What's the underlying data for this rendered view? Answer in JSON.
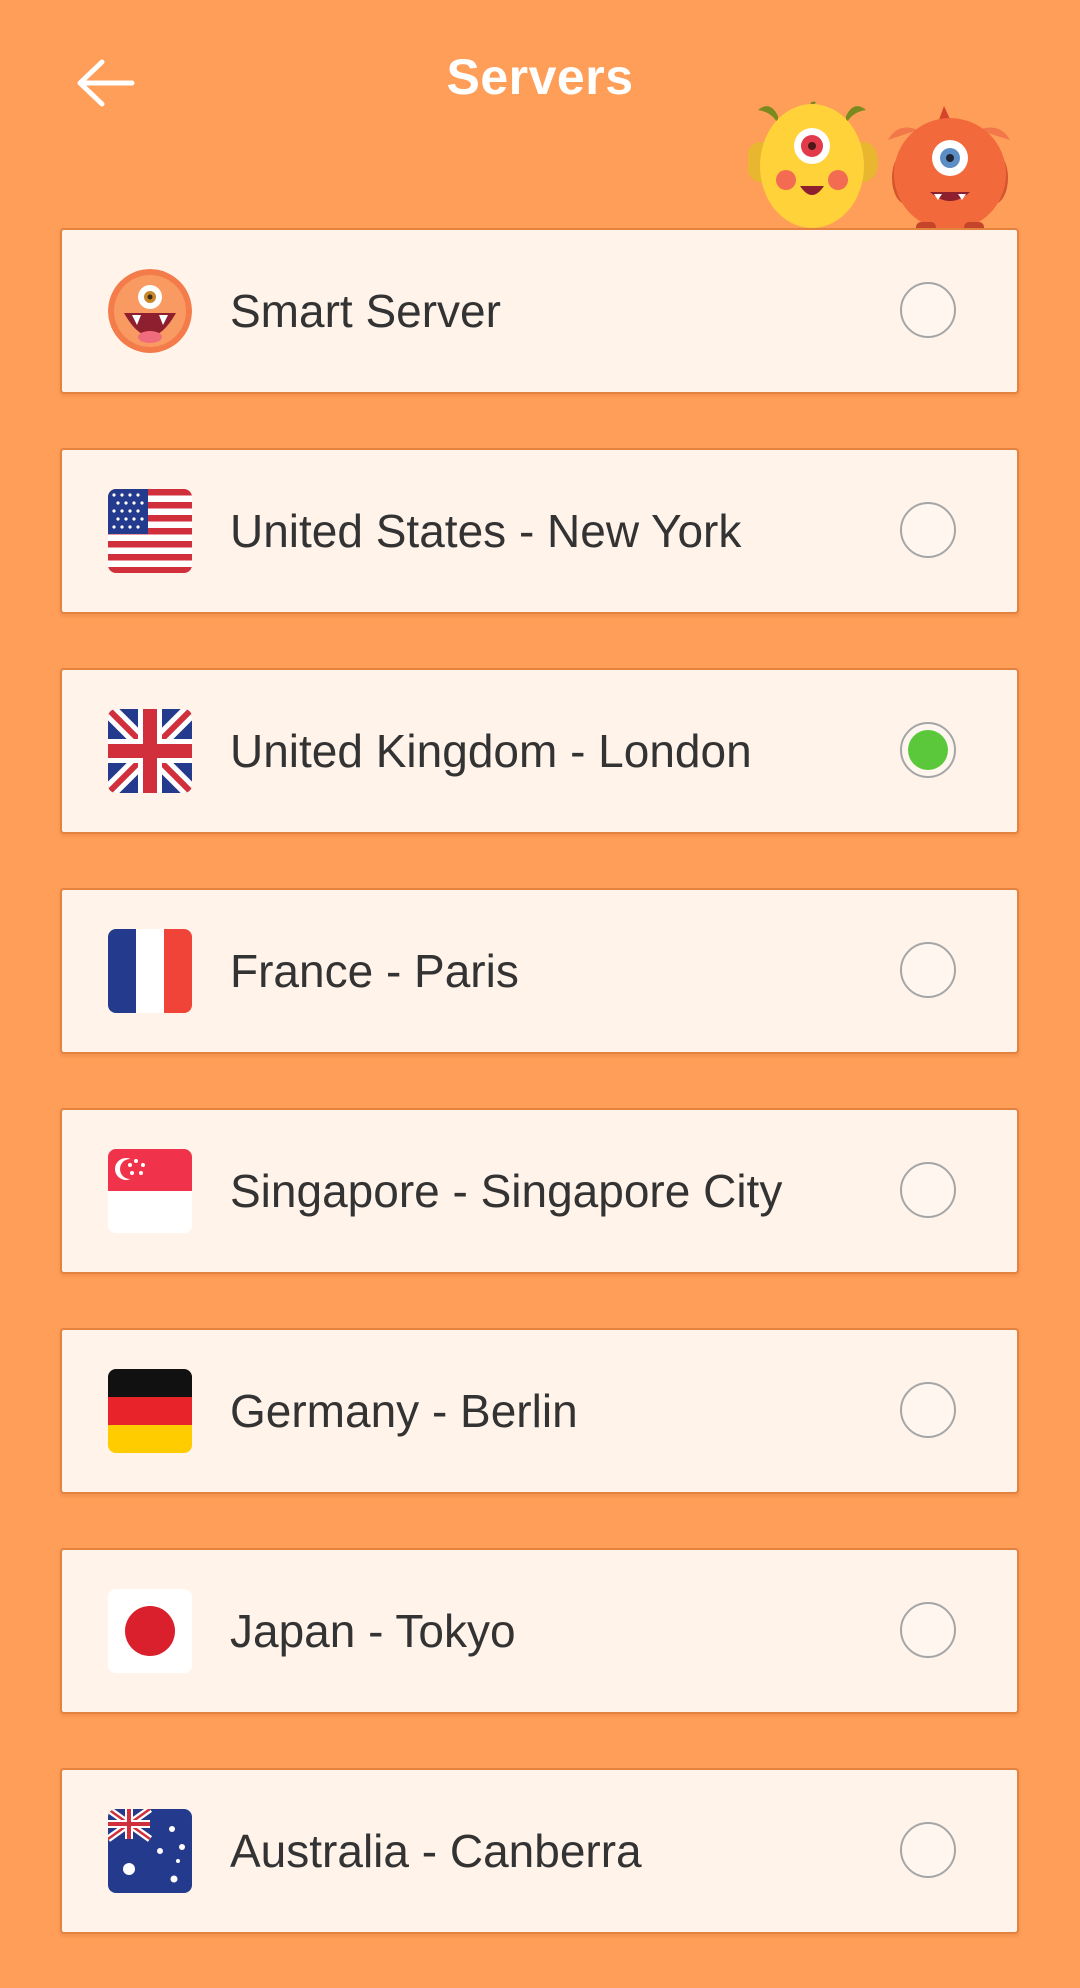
{
  "header": {
    "title": "Servers",
    "back_icon": "arrow-left-icon",
    "mascots": "monster-mascots-illustration"
  },
  "servers": [
    {
      "label": "Smart Server",
      "icon": "smart-monster-icon",
      "selected": false
    },
    {
      "label": "United States - New York",
      "icon": "flag-us-icon",
      "selected": false
    },
    {
      "label": "United Kingdom - London",
      "icon": "flag-uk-icon",
      "selected": true
    },
    {
      "label": "France - Paris",
      "icon": "flag-france-icon",
      "selected": false
    },
    {
      "label": "Singapore - Singapore City",
      "icon": "flag-singapore-icon",
      "selected": false
    },
    {
      "label": "Germany - Berlin",
      "icon": "flag-germany-icon",
      "selected": false
    },
    {
      "label": "Japan - Tokyo",
      "icon": "flag-japan-icon",
      "selected": false
    },
    {
      "label": "Australia - Canberra",
      "icon": "flag-australia-icon",
      "selected": false
    }
  ],
  "colors": {
    "background": "#FF9E58",
    "card": "#FFF3EA",
    "card_border": "#E38340",
    "selected_dot": "#5AC83A",
    "text": "#333333"
  }
}
